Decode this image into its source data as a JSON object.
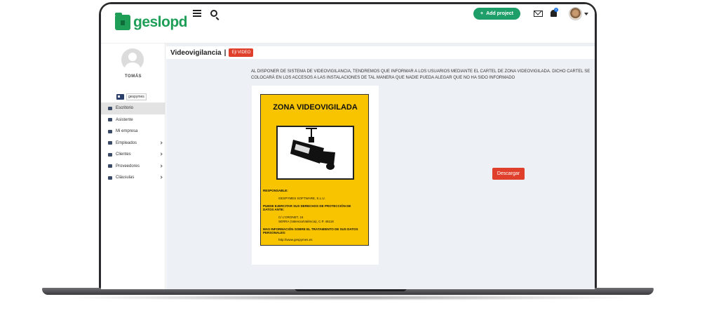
{
  "app": {
    "logo_text": "geslopd"
  },
  "header": {
    "add_project_label": "Add project",
    "notification_count": "0"
  },
  "sidebar": {
    "user_name": "TOMÁS",
    "company": "gespymes",
    "items": [
      {
        "label": "Escritorio",
        "icon": "home-icon",
        "active": true
      },
      {
        "label": "Asistente",
        "icon": "wand-icon"
      },
      {
        "label": "Mi empresa",
        "icon": "building-icon"
      },
      {
        "label": "Empleados",
        "icon": "users-icon",
        "submenu": true
      },
      {
        "label": "Clientes",
        "icon": "users-icon",
        "submenu": true
      },
      {
        "label": "Proveedores",
        "icon": "users-icon",
        "submenu": true
      },
      {
        "label": "Cláusulas",
        "icon": "file-icon",
        "submenu": true
      }
    ]
  },
  "main": {
    "title": "Videovigilancia",
    "separator": "|",
    "badge": "Ejl VIDEO",
    "description": "AL DISPONER DE SISTEMA DE VIDEOVIGILANCIA, TENDREMOS QUE INFORMAR A LOS USUARIOS MEDIANTE EL CARTEL DE ZONA VIDEOVIGILADA. DICHO CARTEL SE COLOCARÁ EN LOS ACCESOS A LAS INSTALACIONES DE TAL MANERA QUE NADIE PUEDA ALEGAR QUE NO HA SIDO INFORMADO",
    "download_label": "Descargar"
  },
  "sign": {
    "title": "ZONA VIDEOVIGILADA",
    "responsable_label": "RESPONSABLE:",
    "responsable_value": "GESPYMES SOFTWARE, S.L.U.",
    "rights_label_1": "PUEDE EJERCITAR SUS DERECHOS DE PROTECCIÓN DE",
    "rights_label_2": "DATOS ANTE:",
    "address_1": "C/ L'ORONET, 15",
    "address_2": "SERRA (Valencia/València), C.P. 46118",
    "info_label_1": "MAS INFORMACIÓN SOBRE EL TRATAMIENTO DE SUS DATOS",
    "info_label_2": "PERSONALES:",
    "url": "http://www.gespymes.es"
  },
  "colors": {
    "brand": "#1e9e57",
    "danger": "#e0402b",
    "sign": "#f8c400"
  }
}
